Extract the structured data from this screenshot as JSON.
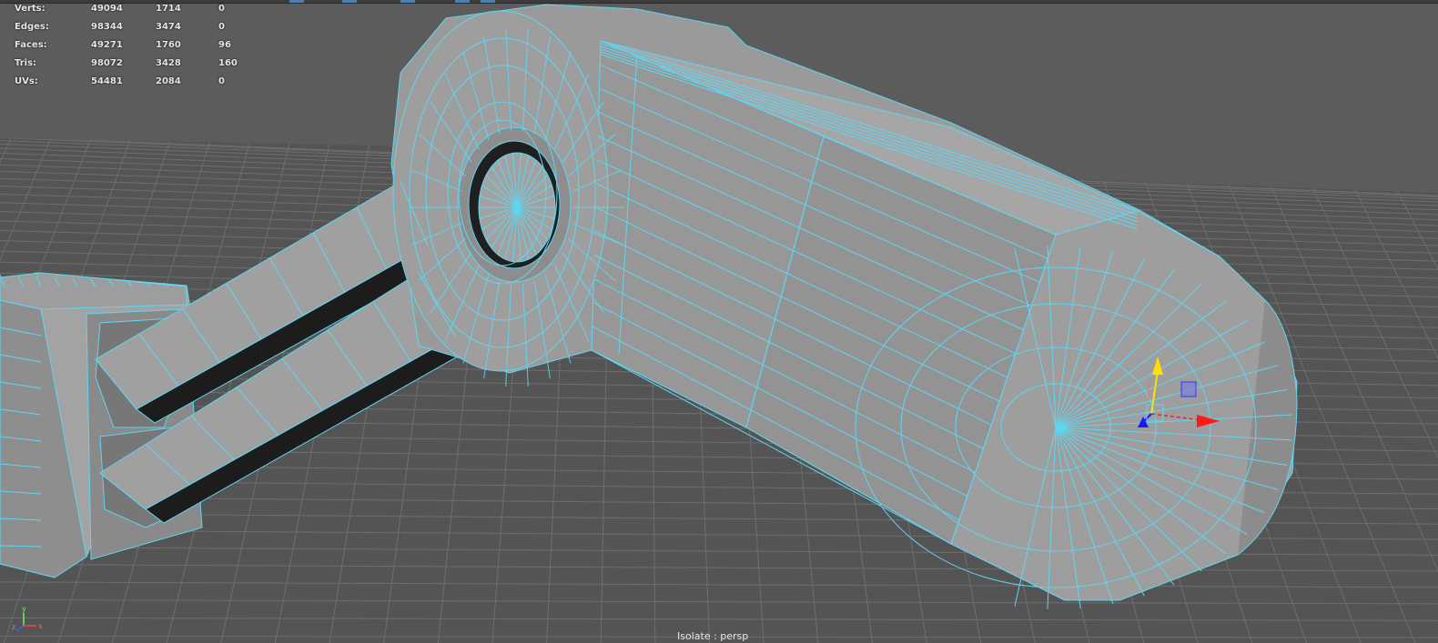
{
  "hud": {
    "rows": [
      {
        "label": "Verts:",
        "c1": "49094",
        "c2": "1714",
        "c3": "0"
      },
      {
        "label": "Edges:",
        "c1": "98344",
        "c2": "3474",
        "c3": "0"
      },
      {
        "label": "Faces:",
        "c1": "49271",
        "c2": "1760",
        "c3": "96"
      },
      {
        "label": "Tris:",
        "c1": "98072",
        "c2": "3428",
        "c3": "160"
      },
      {
        "label": "UVs:",
        "c1": "54481",
        "c2": "2084",
        "c3": "0"
      }
    ]
  },
  "camera_label": "Isolate : persp",
  "axis_gizmo": {
    "y": "y",
    "z": "z",
    "x": "x"
  },
  "colors": {
    "background": "#5c5c5c",
    "grid_line": "#6a6a6a",
    "wireframe": "#5fd6f2",
    "mesh_face": "#9a9a9a",
    "gizmo_x": "#ff1a1a",
    "gizmo_y": "#ffe000",
    "gizmo_z": "#1a1aff"
  },
  "icons": [
    "move-manipulator-icon",
    "axis-orientation-icon"
  ]
}
